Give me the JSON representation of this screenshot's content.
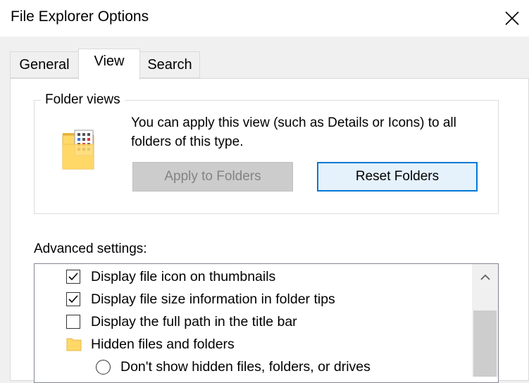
{
  "window": {
    "title": "File Explorer Options"
  },
  "tabs": [
    {
      "label": "General",
      "selected": false
    },
    {
      "label": "View",
      "selected": true
    },
    {
      "label": "Search",
      "selected": false
    }
  ],
  "folder_views": {
    "legend": "Folder views",
    "description": "You can apply this view (such as Details or Icons) to all folders of this type.",
    "apply_button": {
      "label": "Apply to Folders",
      "enabled": false
    },
    "reset_button": {
      "label": "Reset Folders",
      "enabled": true
    }
  },
  "advanced": {
    "label": "Advanced settings:",
    "items": [
      {
        "type": "checkbox",
        "label": "Display file icon on thumbnails",
        "checked": true
      },
      {
        "type": "checkbox",
        "label": "Display file size information in folder tips",
        "checked": true
      },
      {
        "type": "checkbox",
        "label": "Display the full path in the title bar",
        "checked": false
      },
      {
        "type": "folder",
        "label": "Hidden files and folders"
      },
      {
        "type": "radio",
        "label": "Don't show hidden files, folders, or drives",
        "checked": false
      }
    ]
  },
  "icons": {
    "close": "close-icon",
    "folder_views": "folder-views-icon",
    "group_folder": "folder-icon",
    "scroll_up": "chevron-up-icon"
  },
  "colors": {
    "accent": "#0078d7",
    "reset_button_bg": "#e5f1fb",
    "disabled_button_bg": "#cccccc",
    "folder_yellow": "#ffd867"
  }
}
